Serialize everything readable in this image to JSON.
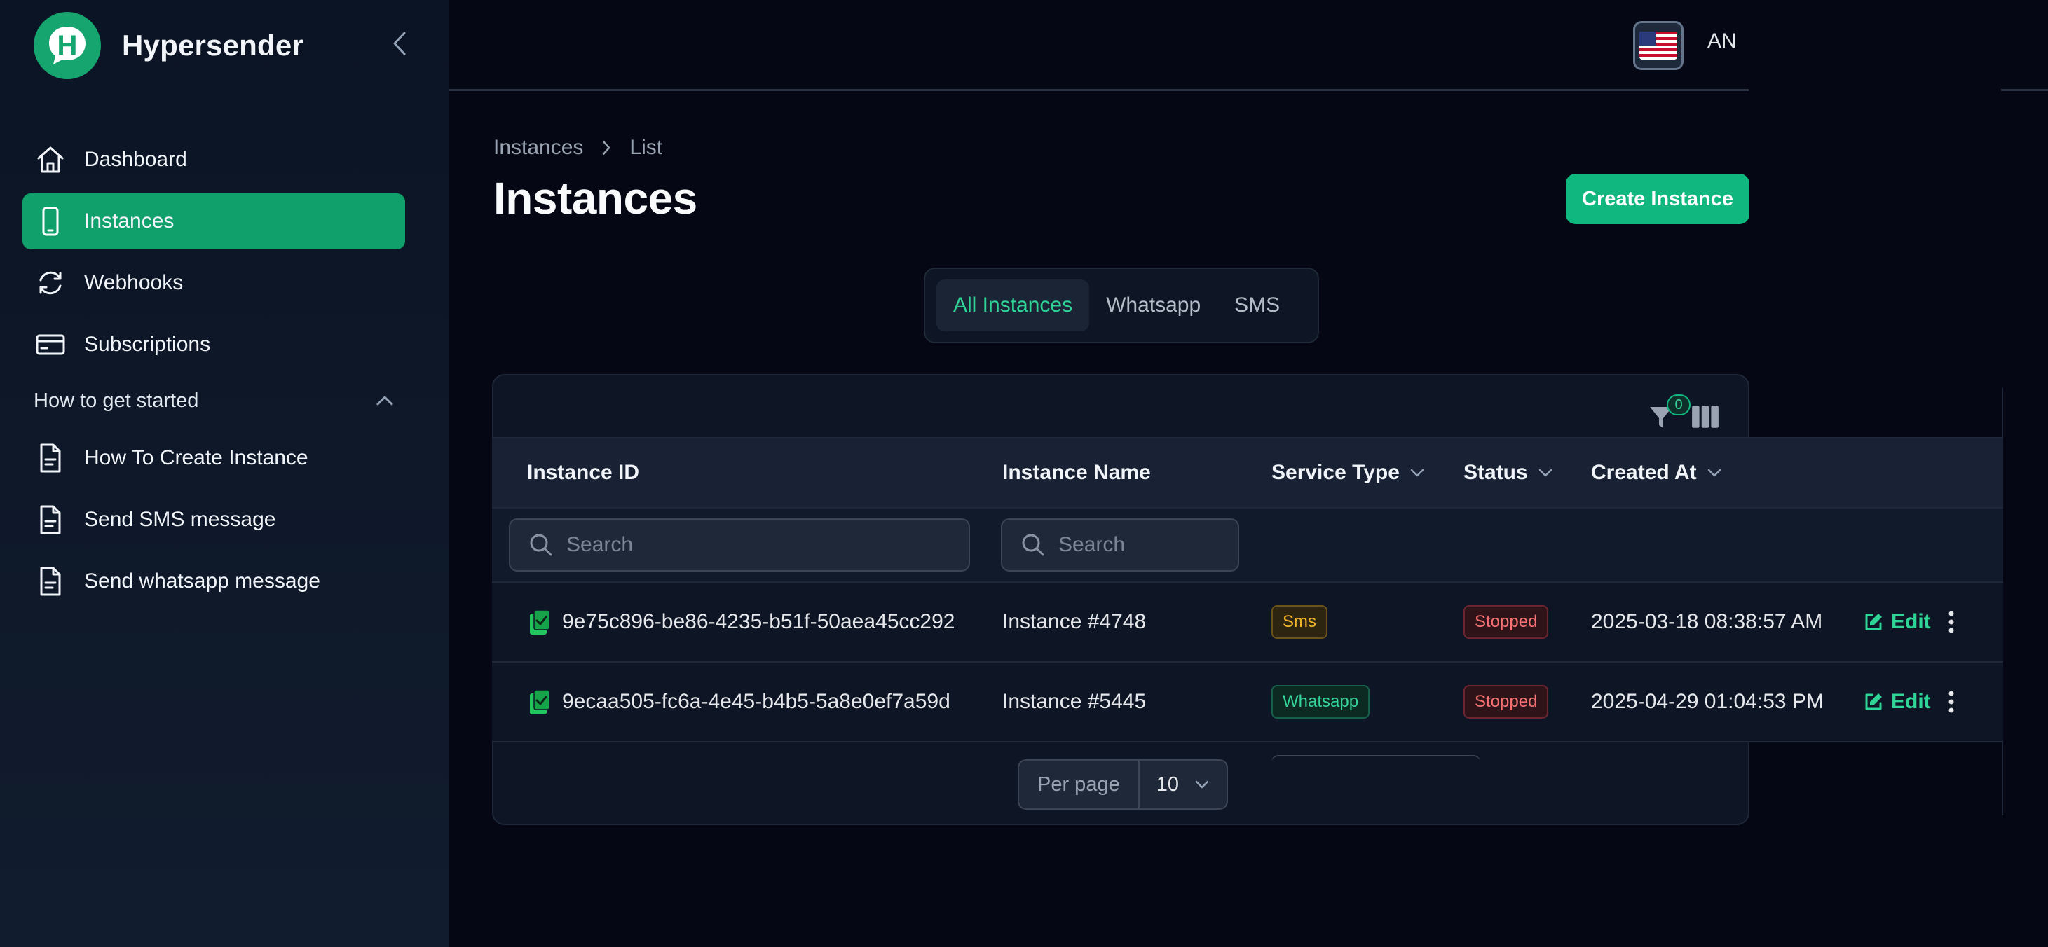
{
  "app": {
    "name": "Hypersender",
    "logo_letter": "H"
  },
  "sidebar": {
    "items": [
      {
        "label": "Dashboard",
        "icon": "home-icon",
        "active": false
      },
      {
        "label": "Instances",
        "icon": "phone-icon",
        "active": true
      },
      {
        "label": "Webhooks",
        "icon": "refresh-icon",
        "active": false
      },
      {
        "label": "Subscriptions",
        "icon": "credit-card-icon",
        "active": false
      }
    ],
    "group": {
      "label": "How to get started",
      "expanded": true,
      "items": [
        {
          "label": "How To Create Instance",
          "icon": "document-icon"
        },
        {
          "label": "Send SMS message",
          "icon": "document-icon"
        },
        {
          "label": "Send whatsapp message",
          "icon": "document-icon"
        }
      ]
    }
  },
  "topbar": {
    "language": "us-flag-icon",
    "user_initials": "AN"
  },
  "breadcrumb": {
    "root": "Instances",
    "current": "List"
  },
  "page": {
    "title": "Instances",
    "create_button": "Create Instance"
  },
  "tabs": [
    {
      "label": "All Instances",
      "active": true
    },
    {
      "label": "Whatsapp",
      "active": false
    },
    {
      "label": "SMS",
      "active": false
    }
  ],
  "table": {
    "filter_count": "0",
    "columns": {
      "instance_id": "Instance ID",
      "instance_name": "Instance Name",
      "service_type": "Service Type",
      "status": "Status",
      "created_at": "Created At"
    },
    "search_placeholder": "Search",
    "rows": [
      {
        "id": "9e75c896-be86-4235-b51f-50aea45cc292",
        "name": "Instance #4748",
        "service": "Sms",
        "status": "Stopped",
        "created": "2025-03-18 08:38:57 AM",
        "edit": "Edit"
      },
      {
        "id": "9ecaa505-fc6a-4e45-b4b5-5a8e0ef7a59d",
        "name": "Instance #5445",
        "service": "Whatsapp",
        "status": "Stopped",
        "created": "2025-04-29 01:04:53 PM",
        "edit": "Edit"
      }
    ],
    "pagination": {
      "per_page_label": "Per page",
      "per_page_value": "10"
    }
  },
  "colors": {
    "accent": "#10b77f",
    "sidebar_active": "#10a06b",
    "background": "#050814"
  }
}
